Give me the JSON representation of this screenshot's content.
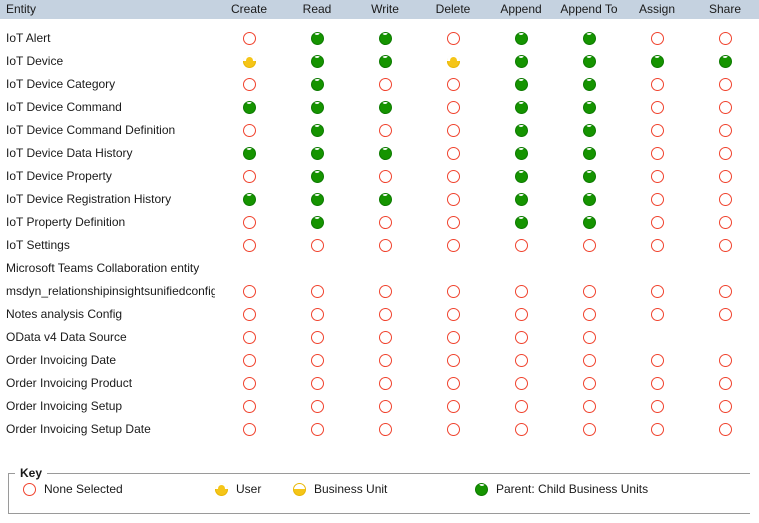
{
  "table": {
    "columns": [
      {
        "key": "entity",
        "label": "Entity"
      },
      {
        "key": "create",
        "label": "Create"
      },
      {
        "key": "read",
        "label": "Read"
      },
      {
        "key": "write",
        "label": "Write"
      },
      {
        "key": "delete",
        "label": "Delete"
      },
      {
        "key": "append",
        "label": "Append"
      },
      {
        "key": "appendto",
        "label": "Append To"
      },
      {
        "key": "assign",
        "label": "Assign"
      },
      {
        "key": "share",
        "label": "Share"
      }
    ],
    "rows": [
      {
        "entity": "IoT Alert",
        "values": [
          "none",
          "pcbu",
          "pcbu",
          "none",
          "pcbu",
          "pcbu",
          "none",
          "none"
        ]
      },
      {
        "entity": "IoT Device",
        "values": [
          "user",
          "pcbu",
          "pcbu",
          "user",
          "pcbu",
          "pcbu",
          "pcbu",
          "pcbu"
        ]
      },
      {
        "entity": "IoT Device Category",
        "values": [
          "none",
          "pcbu",
          "none",
          "none",
          "pcbu",
          "pcbu",
          "none",
          "none"
        ]
      },
      {
        "entity": "IoT Device Command",
        "values": [
          "pcbu",
          "pcbu",
          "pcbu",
          "none",
          "pcbu",
          "pcbu",
          "none",
          "none"
        ]
      },
      {
        "entity": "IoT Device Command Definition",
        "values": [
          "none",
          "pcbu",
          "none",
          "none",
          "pcbu",
          "pcbu",
          "none",
          "none"
        ]
      },
      {
        "entity": "IoT Device Data History",
        "values": [
          "pcbu",
          "pcbu",
          "pcbu",
          "none",
          "pcbu",
          "pcbu",
          "none",
          "none"
        ]
      },
      {
        "entity": "IoT Device Property",
        "values": [
          "none",
          "pcbu",
          "none",
          "none",
          "pcbu",
          "pcbu",
          "none",
          "none"
        ]
      },
      {
        "entity": "IoT Device Registration History",
        "values": [
          "pcbu",
          "pcbu",
          "pcbu",
          "none",
          "pcbu",
          "pcbu",
          "none",
          "none"
        ]
      },
      {
        "entity": "IoT Property Definition",
        "values": [
          "none",
          "pcbu",
          "none",
          "none",
          "pcbu",
          "pcbu",
          "none",
          "none"
        ]
      },
      {
        "entity": "IoT Settings",
        "values": [
          "none",
          "none",
          "none",
          "none",
          "none",
          "none",
          "none",
          "none"
        ]
      },
      {
        "entity": "Microsoft Teams Collaboration entity",
        "values": [
          "blank",
          "blank",
          "blank",
          "blank",
          "blank",
          "blank",
          "blank",
          "blank"
        ]
      },
      {
        "entity": "msdyn_relationshipinsightsunifiedconfig",
        "values": [
          "none",
          "none",
          "none",
          "none",
          "none",
          "none",
          "none",
          "none"
        ]
      },
      {
        "entity": "Notes analysis Config",
        "values": [
          "none",
          "none",
          "none",
          "none",
          "none",
          "none",
          "none",
          "none"
        ]
      },
      {
        "entity": "OData v4 Data Source",
        "values": [
          "none",
          "none",
          "none",
          "none",
          "none",
          "none",
          "blank",
          "blank"
        ]
      },
      {
        "entity": "Order Invoicing Date",
        "values": [
          "none",
          "none",
          "none",
          "none",
          "none",
          "none",
          "none",
          "none"
        ]
      },
      {
        "entity": "Order Invoicing Product",
        "values": [
          "none",
          "none",
          "none",
          "none",
          "none",
          "none",
          "none",
          "none"
        ]
      },
      {
        "entity": "Order Invoicing Setup",
        "values": [
          "none",
          "none",
          "none",
          "none",
          "none",
          "none",
          "none",
          "none"
        ]
      },
      {
        "entity": "Order Invoicing Setup Date",
        "values": [
          "none",
          "none",
          "none",
          "none",
          "none",
          "none",
          "none",
          "none"
        ]
      }
    ]
  },
  "key": {
    "title": "Key",
    "items": [
      {
        "id": "none",
        "icon": "none-selected-icon",
        "label": "None Selected"
      },
      {
        "id": "user",
        "icon": "user-icon",
        "label": "User"
      },
      {
        "id": "bu",
        "icon": "business-unit-icon",
        "label": "Business Unit"
      },
      {
        "id": "pcbu",
        "icon": "parent-child-business-units-icon",
        "label": "Parent: Child Business Units"
      }
    ]
  },
  "colors": {
    "header_background": "#c5d2e0",
    "none_selected": "#f0432e",
    "user": "#f5c518",
    "business_unit": "#f5c518",
    "parent_child_business_units": "#159400",
    "key_border": "#9a9a9a"
  }
}
